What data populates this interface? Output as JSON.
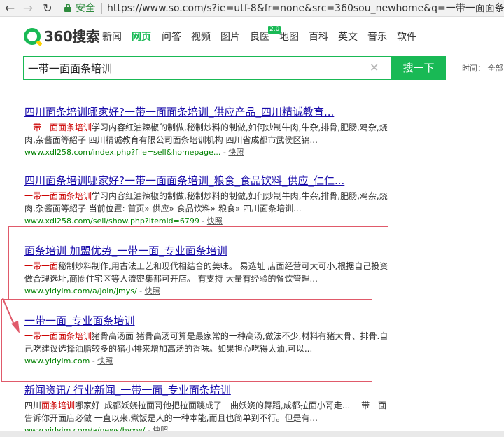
{
  "browser": {
    "back_icon": "back-arrow-icon",
    "forward_icon": "forward-arrow-icon",
    "reload_icon": "reload-icon",
    "secure_label": "安全",
    "url": "https://www.so.com/s?ie=utf-8&fr=none&src=360sou_newhome&q=一带一面面条培训"
  },
  "header": {
    "logo_text": "360搜索",
    "nav": [
      "新闻",
      "网页",
      "问答",
      "视频",
      "图片",
      "良医",
      "地图",
      "百科",
      "英文",
      "音乐",
      "软件"
    ],
    "active_tab": "网页",
    "badge": "2.0",
    "search_value": "一带一面面条培训",
    "search_button": "搜一下",
    "time_filter": "时间： 全部",
    "brand_color": "#19b955"
  },
  "results": [
    {
      "title": "四川面条培训哪家好?一带一面面条培训_供应产品_四川精诚教育...",
      "desc_hl": "一带一面面条培训",
      "desc": "学习内容红油辣椒的制做,秘制炒料的制做,如何炒制牛肉,牛杂,排骨,肥肠,鸡杂,烧肉,杂酱面等紹子 四川精诚教育有限公司面条培训机构 四川省成都市武侯区锦...",
      "url": "www.xdl258.com/index.php?file=sell&homepage...",
      "snapshot": "快照"
    },
    {
      "title": "四川面条培训哪家好?一带一面面条培训_粮食_食品饮料_供应_仁仁...",
      "desc_hl": "一带一面面条培训",
      "desc": "学习内容红油辣椒的制做,秘制炒料的制做,如何炒制牛肉,牛杂,排骨,肥肠,鸡杂,烧肉,杂酱面等紹子 当前位置: 首页» 供应» 食品饮料» 粮食» 四川面条培训...",
      "url": "www.xdl258.com/sell/show.php?itemid=6799",
      "snapshot": "快照"
    },
    {
      "title": "面条培训 加盟优势_一带一面_专业面条培训",
      "desc_hl": "一带一面",
      "desc": "秘制炒料制作,用古法工艺和现代相结合的美味。 易选址 店面经营可大可小,根据自己投资做合理选址,商圈住宅区等人流密集都可开店。 有支持 大量有经验的餐饮管理...",
      "url": "www.yidyim.com/a/join/jmys/",
      "snapshot": "快照"
    },
    {
      "title": "一带一面_专业面条培训",
      "desc_hl": "一带一面面条培训",
      "desc": "猪骨高汤面 猪骨高汤可算是最家常的一种高汤,做法不少,材料有猪大骨、排骨.自己吃建议选择油脂较多的猪小排来增加高汤的香味。如果担心吃得太油,可以...",
      "url": "www.yidyim.com",
      "snapshot": "快照"
    },
    {
      "title": "新闻资讯/ 行业新闻_一带一面_专业面条培训",
      "desc_pre": "四川",
      "desc_hl": "面条培训",
      "desc": "哪家好_成都妖娆拉面哥他把拉面跳成了一曲妖娆的舞蹈,成都拉面小哥走... 一带一面告诉你开面店必做 一直以来,煮饭是人的一种本能,而且也简单到不行。但是有...",
      "url": "www.yidyim.com/a/news/hyxw/",
      "snapshot": "快照"
    }
  ],
  "annotation": {
    "highlight_color": "#e05a6a"
  }
}
